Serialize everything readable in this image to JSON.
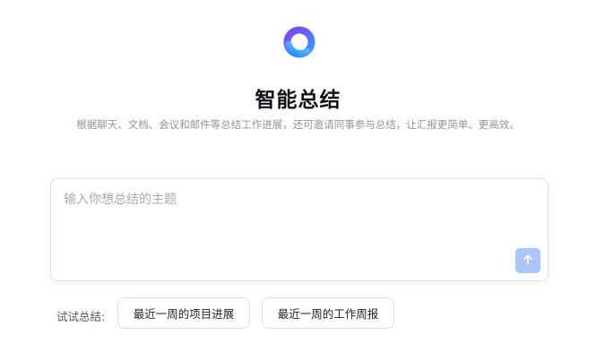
{
  "header": {
    "title": "智能总结",
    "subtitle": "根据聊天、文档、会议和邮件等总结工作进展，还可邀请同事参与总结，让汇报更简单、更高效。"
  },
  "logo": {
    "icon": "ring-logo-icon"
  },
  "composer": {
    "placeholder": "输入你想总结的主题",
    "value": "",
    "send_icon": "arrow-up-icon",
    "send_button_color": "#a9c6fb"
  },
  "suggestions": {
    "label": "试试总结:",
    "items": [
      {
        "label": "最近一周的项目进展"
      },
      {
        "label": "最近一周的工作周报"
      }
    ]
  },
  "colors": {
    "accent_gradient_start": "#7b4cf6",
    "accent_gradient_end": "#2f9bff"
  }
}
